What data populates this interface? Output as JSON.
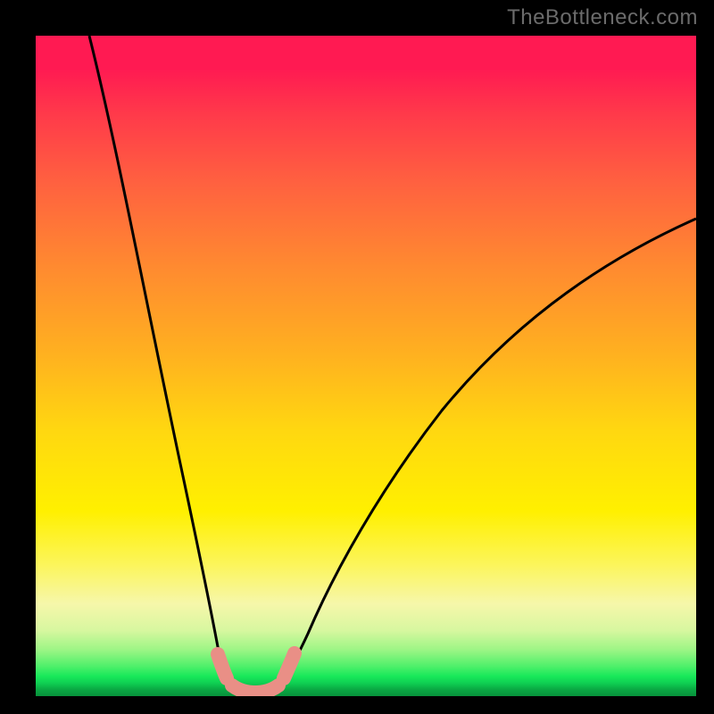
{
  "attribution": "TheBottleneck.com",
  "chart_data": {
    "type": "line",
    "title": "",
    "xlabel": "",
    "ylabel": "",
    "xlim": [
      0,
      100
    ],
    "ylim": [
      0,
      100
    ],
    "background_gradient": {
      "stops": [
        {
          "pos": 0,
          "color": "#ff1a52"
        },
        {
          "pos": 35,
          "color": "#ff8a30"
        },
        {
          "pos": 60,
          "color": "#ffd810"
        },
        {
          "pos": 86,
          "color": "#f6f7aa"
        },
        {
          "pos": 97,
          "color": "#18e85a"
        },
        {
          "pos": 100,
          "color": "#07913b"
        }
      ]
    },
    "series": [
      {
        "name": "left-curve",
        "stroke": "#000000",
        "x": [
          8,
          10,
          12,
          14,
          16,
          18,
          20,
          22,
          23.5,
          25,
          26.5,
          28.5
        ],
        "y": [
          100,
          90,
          79,
          68,
          57,
          46,
          34,
          22,
          14,
          8,
          4,
          2
        ]
      },
      {
        "name": "right-curve",
        "stroke": "#000000",
        "x": [
          36,
          38,
          40,
          43,
          47,
          52,
          58,
          66,
          76,
          88,
          100
        ],
        "y": [
          2,
          4,
          8,
          14,
          22,
          30,
          38,
          47,
          56,
          65,
          72
        ]
      },
      {
        "name": "trough-flat",
        "stroke": "#000000",
        "x": [
          28.5,
          30,
          32,
          34,
          36
        ],
        "y": [
          2,
          1.4,
          1.2,
          1.4,
          2
        ]
      },
      {
        "name": "marker-band",
        "stroke": "#e98f86",
        "marker": true,
        "x": [
          26.5,
          27.5,
          28.5,
          30,
          32,
          34,
          35.5,
          36.5,
          37.5
        ],
        "y": [
          5.0,
          3.5,
          2.2,
          1.6,
          1.4,
          1.6,
          2.2,
          3.5,
          5.0
        ]
      }
    ]
  }
}
